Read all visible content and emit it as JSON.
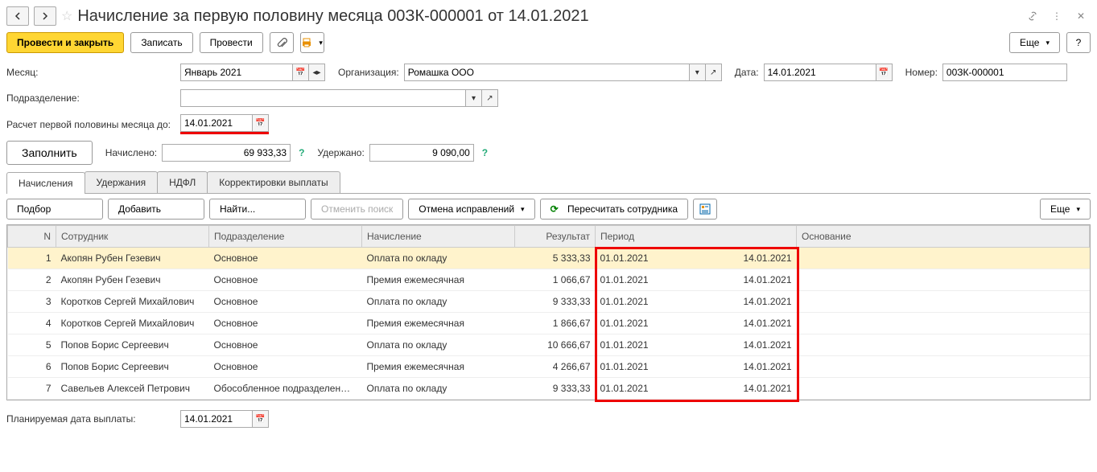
{
  "header": {
    "title": "Начисление за первую половину месяца 00ЗК-000001 от 14.01.2021"
  },
  "toolbar": {
    "post_close": "Провести и закрыть",
    "save": "Записать",
    "post": "Провести",
    "more": "Еще"
  },
  "fields": {
    "month_label": "Месяц:",
    "month_value": "Январь 2021",
    "org_label": "Организация:",
    "org_value": "Ромашка ООО",
    "date_label": "Дата:",
    "date_value": "14.01.2021",
    "number_label": "Номер:",
    "number_value": "00ЗК-000001",
    "dept_label": "Подразделение:",
    "dept_value": "",
    "calc_until_label": "Расчет первой половины месяца до:",
    "calc_until_value": "14.01.2021",
    "fill": "Заполнить",
    "accrued_label": "Начислено:",
    "accrued_value": "69 933,33",
    "withheld_label": "Удержано:",
    "withheld_value": "9 090,00"
  },
  "tabs": [
    "Начисления",
    "Удержания",
    "НДФЛ",
    "Корректировки выплаты"
  ],
  "subtoolbar": {
    "select": "Подбор",
    "add": "Добавить",
    "find": "Найти...",
    "cancel_search": "Отменить поиск",
    "cancel_corrections": "Отмена исправлений",
    "recalc_employee": "Пересчитать сотрудника",
    "more": "Еще"
  },
  "table": {
    "columns": [
      "N",
      "Сотрудник",
      "Подразделение",
      "Начисление",
      "Результат",
      "Период",
      "Основание"
    ],
    "rows": [
      {
        "n": 1,
        "emp": "Акопян Рубен Гезевич",
        "dep": "Основное",
        "acc": "Оплата по окладу",
        "res": "5 333,33",
        "from": "01.01.2021",
        "to": "14.01.2021",
        "selected": true
      },
      {
        "n": 2,
        "emp": "Акопян Рубен Гезевич",
        "dep": "Основное",
        "acc": "Премия ежемесячная",
        "res": "1 066,67",
        "from": "01.01.2021",
        "to": "14.01.2021"
      },
      {
        "n": 3,
        "emp": "Коротков Сергей Михайлович",
        "dep": "Основное",
        "acc": "Оплата по окладу",
        "res": "9 333,33",
        "from": "01.01.2021",
        "to": "14.01.2021"
      },
      {
        "n": 4,
        "emp": "Коротков Сергей Михайлович",
        "dep": "Основное",
        "acc": "Премия ежемесячная",
        "res": "1 866,67",
        "from": "01.01.2021",
        "to": "14.01.2021"
      },
      {
        "n": 5,
        "emp": "Попов Борис Сергеевич",
        "dep": "Основное",
        "acc": "Оплата по окладу",
        "res": "10 666,67",
        "from": "01.01.2021",
        "to": "14.01.2021"
      },
      {
        "n": 6,
        "emp": "Попов Борис Сергеевич",
        "dep": "Основное",
        "acc": "Премия ежемесячная",
        "res": "4 266,67",
        "from": "01.01.2021",
        "to": "14.01.2021"
      },
      {
        "n": 7,
        "emp": "Савельев Алексей Петрович",
        "dep": "Обособленное подразделен…",
        "acc": "Оплата по окладу",
        "res": "9 333,33",
        "from": "01.01.2021",
        "to": "14.01.2021"
      }
    ]
  },
  "footer": {
    "planned_date_label": "Планируемая дата выплаты:",
    "planned_date_value": "14.01.2021"
  }
}
